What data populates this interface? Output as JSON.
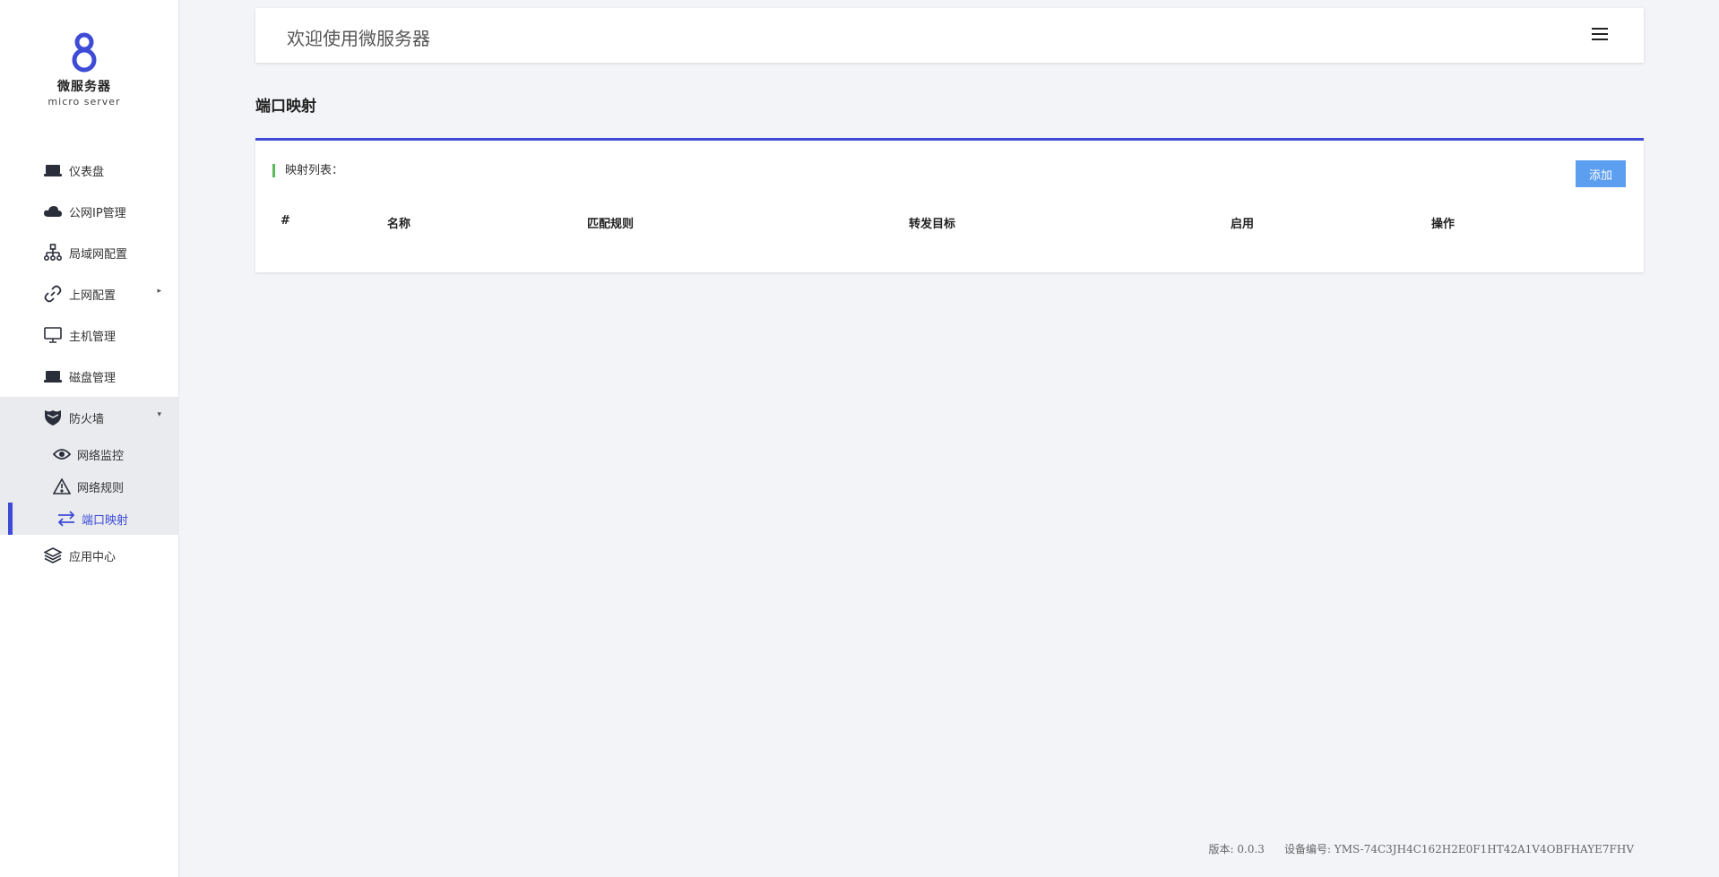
{
  "brand": {
    "name": "微服务器",
    "subtitle": "micro server",
    "accent": "#3d4bd6"
  },
  "sidebar": {
    "items": [
      {
        "label": "仪表盘",
        "icon": "laptop-icon"
      },
      {
        "label": "公网IP管理",
        "icon": "cloud-icon"
      },
      {
        "label": "局域网配置",
        "icon": "sitemap-icon"
      },
      {
        "label": "上网配置",
        "icon": "link-icon",
        "arrow": "▸"
      },
      {
        "label": "主机管理",
        "icon": "monitor-icon"
      },
      {
        "label": "磁盘管理",
        "icon": "disk-icon"
      }
    ],
    "firewall": {
      "label": "防火墙",
      "icon": "shield-icon",
      "arrow": "▾",
      "children": [
        {
          "label": "网络监控",
          "icon": "eye-icon"
        },
        {
          "label": "网络规则",
          "icon": "warning-icon"
        },
        {
          "label": "端口映射",
          "icon": "exchange-icon",
          "active": true
        }
      ]
    },
    "app_center": {
      "label": "应用中心",
      "icon": "layers-icon"
    }
  },
  "header": {
    "title": "欢迎使用微服务器",
    "menu_icon": "hamburger-icon"
  },
  "page": {
    "title": "端口映射"
  },
  "card": {
    "label": "映射列表：",
    "add_button": "添加",
    "columns": [
      "#",
      "名称",
      "匹配规则",
      "转发目标",
      "启用",
      "操作"
    ],
    "rows": []
  },
  "footer": {
    "version": "版本: 0.0.3",
    "device": "设备编号: YMS-74C3JH4C162H2E0F1HT42A1V4OBFHAYE7FHV"
  },
  "colors": {
    "primary": "#3d4bd6",
    "button": "#5c9ef0",
    "label_bar": "#5cb85c",
    "background": "#f3f4f8"
  }
}
